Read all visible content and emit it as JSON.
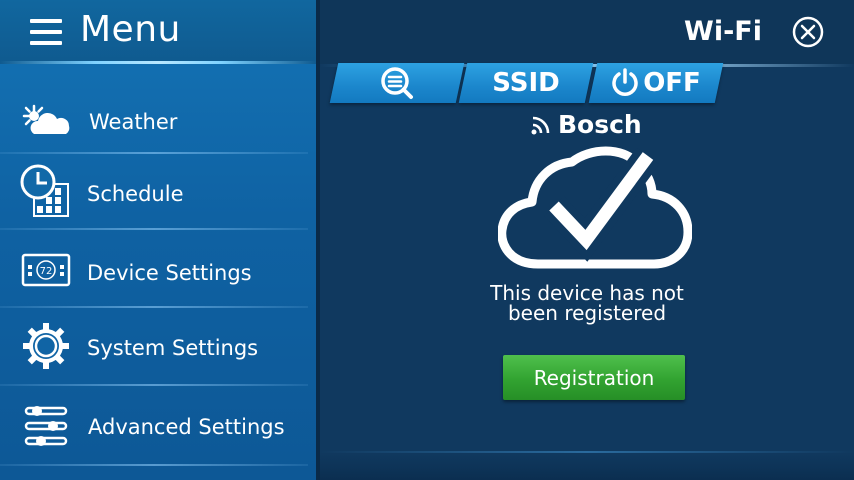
{
  "sidebar": {
    "title": "Menu",
    "items": [
      {
        "label": "Weather",
        "icon": "weather-icon"
      },
      {
        "label": "Schedule",
        "icon": "schedule-icon"
      },
      {
        "label": "Device Settings",
        "icon": "device-settings-icon"
      },
      {
        "label": "System Settings",
        "icon": "gear-icon"
      },
      {
        "label": "Advanced Settings",
        "icon": "sliders-icon"
      }
    ]
  },
  "header": {
    "title": "Wi-Fi"
  },
  "tabs": [
    {
      "label": "",
      "icon": "search-icon"
    },
    {
      "label": "SSID"
    },
    {
      "label": "OFF",
      "icon": "power-icon"
    }
  ],
  "device_icon_text": "72",
  "brand": {
    "name": "Bosch",
    "icon": "wifi-signal-icon"
  },
  "status": {
    "message_line1": "This device has not",
    "message_line2": "been registered"
  },
  "registration_button": {
    "label": "Registration"
  },
  "colors": {
    "sidebar": "#1268aa",
    "main": "#10395f",
    "tab": "#1f8fd4",
    "button": "#35a834"
  }
}
